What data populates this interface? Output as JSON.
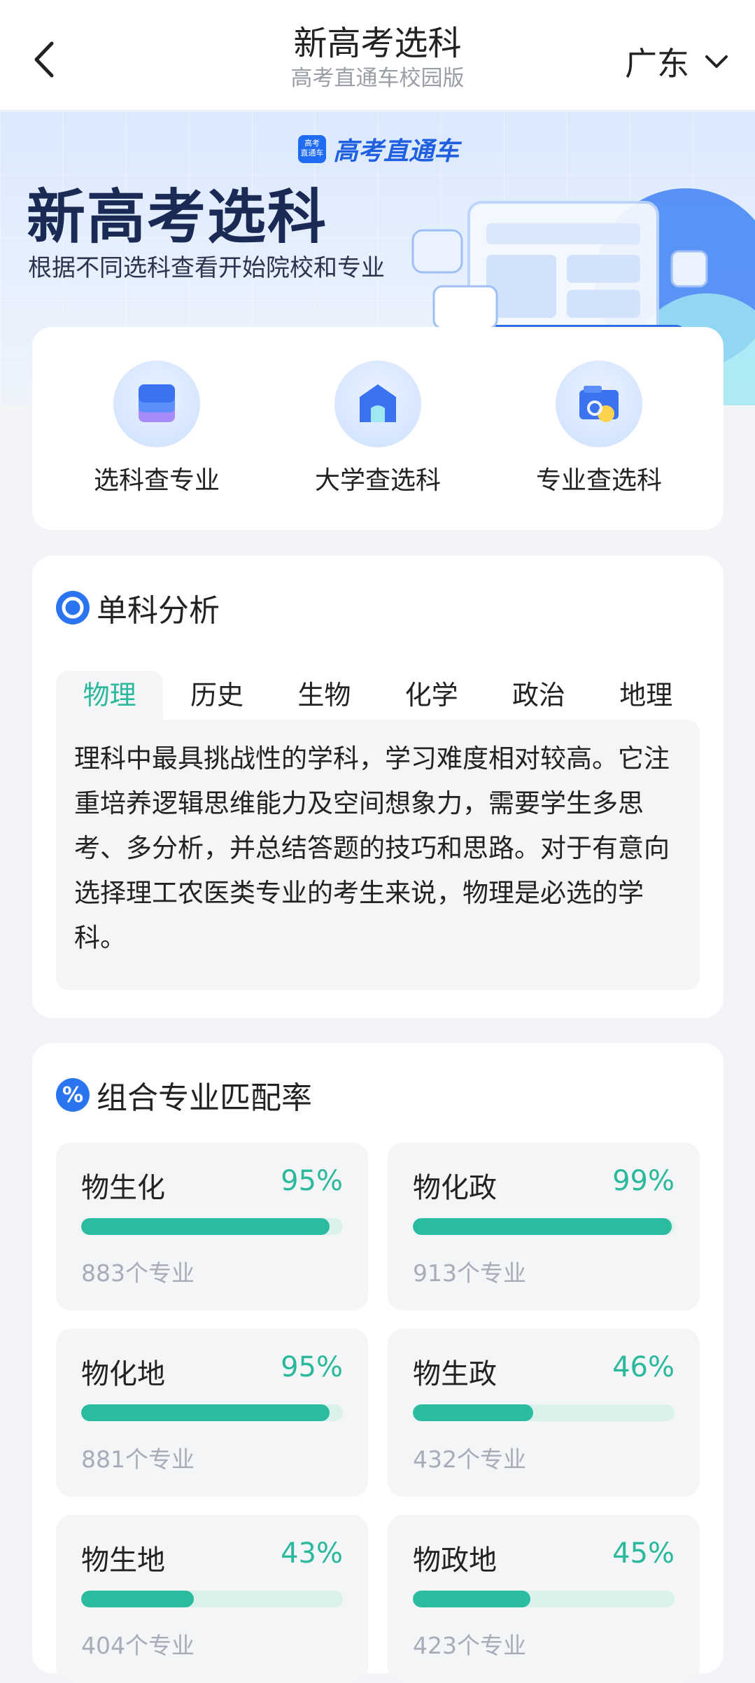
{
  "header": {
    "title": "新高考选科",
    "subtitle": "高考直通车校园版",
    "region": "广东"
  },
  "banner": {
    "brand_logo_text": "高考直通车",
    "brand_name": "高考直通车",
    "title": "新高考选科",
    "description": "根据不同选科查看开始院校和专业"
  },
  "quick_actions": [
    {
      "label": "选科查专业",
      "icon": "stack-icon"
    },
    {
      "label": "大学查选科",
      "icon": "building-icon"
    },
    {
      "label": "专业查选科",
      "icon": "folder-search-icon"
    }
  ],
  "analysis": {
    "title": "单科分析",
    "tabs": [
      "物理",
      "历史",
      "生物",
      "化学",
      "政治",
      "地理"
    ],
    "active_tab": "物理",
    "description": "理科中最具挑战性的学科，学习难度相对较高。它注重培养逻辑思维能力及空间想象力，需要学生多思考、多分析，并总结答题的技巧和思路。对于有意向选择理工农医类专业的考生来说，物理是必选的学科。"
  },
  "combination": {
    "title": "组合专业匹配率",
    "icon_text": "%",
    "items": [
      {
        "name": "物生化",
        "percent": "95%",
        "rate": 95,
        "count": "883个专业"
      },
      {
        "name": "物化政",
        "percent": "99%",
        "rate": 99,
        "count": "913个专业"
      },
      {
        "name": "物化地",
        "percent": "95%",
        "rate": 95,
        "count": "881个专业"
      },
      {
        "name": "物生政",
        "percent": "46%",
        "rate": 46,
        "count": "432个专业"
      },
      {
        "name": "物生地",
        "percent": "43%",
        "rate": 43,
        "count": "404个专业"
      },
      {
        "name": "物政地",
        "percent": "45%",
        "rate": 45,
        "count": "423个专业"
      }
    ]
  },
  "colors": {
    "accent_blue": "#2a74f0",
    "accent_green": "#2bb89c",
    "bar_track": "#dbf1ec"
  }
}
